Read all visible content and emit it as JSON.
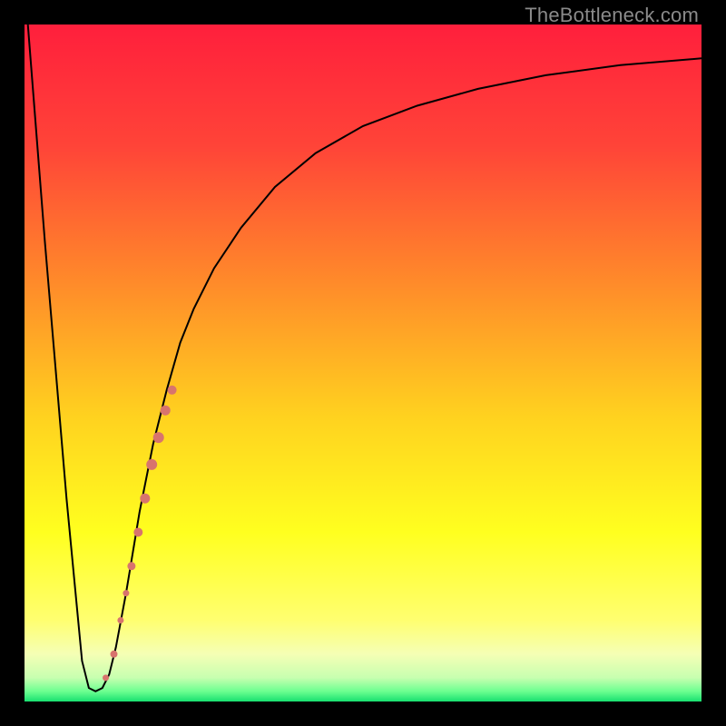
{
  "watermark": "TheBottleneck.com",
  "chart_data": {
    "type": "line",
    "title": "",
    "xlabel": "",
    "ylabel": "",
    "xlim": [
      0,
      100
    ],
    "ylim": [
      0,
      100
    ],
    "grid": false,
    "legend": false,
    "background_gradient": {
      "stops": [
        {
          "pos": 0.0,
          "color": "#ff1f3c"
        },
        {
          "pos": 0.18,
          "color": "#ff4438"
        },
        {
          "pos": 0.38,
          "color": "#ff8a2a"
        },
        {
          "pos": 0.58,
          "color": "#ffd21f"
        },
        {
          "pos": 0.75,
          "color": "#ffff1f"
        },
        {
          "pos": 0.88,
          "color": "#ffff70"
        },
        {
          "pos": 0.93,
          "color": "#f5ffb5"
        },
        {
          "pos": 0.965,
          "color": "#c7ffb0"
        },
        {
          "pos": 0.985,
          "color": "#6cff90"
        },
        {
          "pos": 1.0,
          "color": "#18e070"
        }
      ]
    },
    "series": [
      {
        "name": "bottleneck-curve",
        "stroke": "#000000",
        "x": [
          0.5,
          3.0,
          6.2,
          8.5,
          9.5,
          10.5,
          11.5,
          12.5,
          13.5,
          15.0,
          17.0,
          19.0,
          21.0,
          23.0,
          25.0,
          28.0,
          32.0,
          37.0,
          43.0,
          50.0,
          58.0,
          67.0,
          77.0,
          88.0,
          100.0
        ],
        "values": [
          100,
          68,
          30,
          6,
          2,
          1.5,
          2,
          4,
          8,
          16,
          28,
          38,
          46,
          53,
          58,
          64,
          70,
          76,
          81,
          85,
          88,
          90.5,
          92.5,
          94,
          95
        ]
      }
    ],
    "markers": {
      "name": "highlight-dots",
      "color": "#d8746d",
      "points": [
        {
          "x": 12.0,
          "y": 3.5,
          "r": 3.5
        },
        {
          "x": 13.2,
          "y": 7.0,
          "r": 4.0
        },
        {
          "x": 14.2,
          "y": 12.0,
          "r": 3.5
        },
        {
          "x": 15.0,
          "y": 16.0,
          "r": 3.5
        },
        {
          "x": 15.8,
          "y": 20.0,
          "r": 4.5
        },
        {
          "x": 16.8,
          "y": 25.0,
          "r": 5.0
        },
        {
          "x": 17.8,
          "y": 30.0,
          "r": 5.5
        },
        {
          "x": 18.8,
          "y": 35.0,
          "r": 6.0
        },
        {
          "x": 19.8,
          "y": 39.0,
          "r": 6.0
        },
        {
          "x": 20.8,
          "y": 43.0,
          "r": 5.5
        },
        {
          "x": 21.8,
          "y": 46.0,
          "r": 5.0
        }
      ]
    }
  }
}
